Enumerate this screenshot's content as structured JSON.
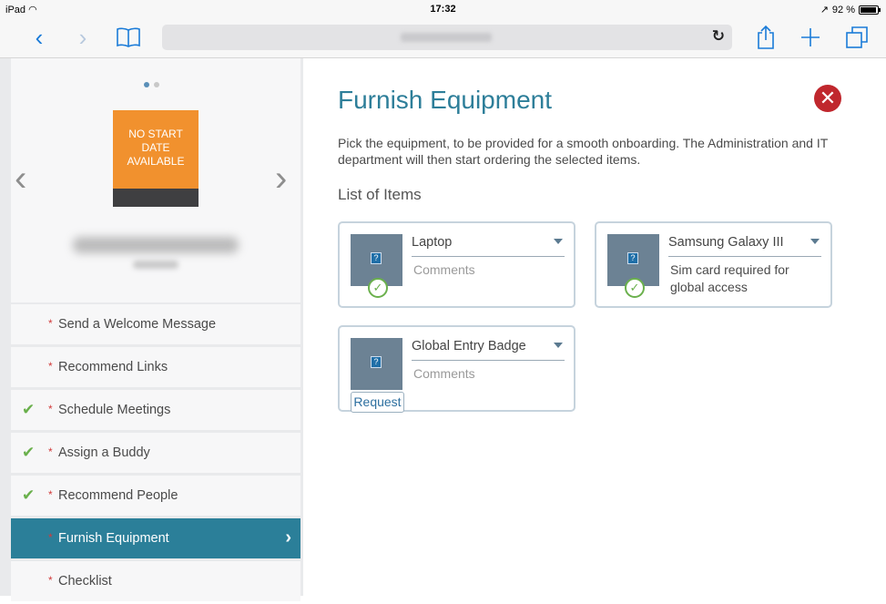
{
  "status_bar": {
    "device": "iPad",
    "time": "17:32",
    "battery": "92 %"
  },
  "browser": {
    "reload_icon": "reload-icon"
  },
  "profile": {
    "photo_text": "NO START DATE AVAILABLE"
  },
  "nav": {
    "items": [
      {
        "label": "Send a Welcome Message",
        "done": false,
        "selected": false
      },
      {
        "label": "Recommend Links",
        "done": false,
        "selected": false
      },
      {
        "label": "Schedule Meetings",
        "done": true,
        "selected": false
      },
      {
        "label": "Assign a Buddy",
        "done": true,
        "selected": false
      },
      {
        "label": "Recommend People",
        "done": true,
        "selected": false
      },
      {
        "label": "Furnish Equipment",
        "done": false,
        "selected": true
      },
      {
        "label": "Checklist",
        "done": false,
        "selected": false
      }
    ]
  },
  "main": {
    "title": "Furnish Equipment",
    "description": "Pick the equipment, to be provided for a smooth onboarding. The Administration and IT department will then start ordering the selected items.",
    "list_title": "List of Items",
    "items": [
      {
        "name": "Laptop",
        "comment": "Comments",
        "comment_is_placeholder": true,
        "requested": true
      },
      {
        "name": "Samsung Galaxy III",
        "comment": "Sim card required for global access",
        "comment_is_placeholder": false,
        "requested": true
      },
      {
        "name": "Global Entry Badge",
        "comment": "Comments",
        "comment_is_placeholder": true,
        "requested": false,
        "request_label": "Request"
      }
    ]
  },
  "colors": {
    "accent": "#2d7e99",
    "selected_nav": "#2b7f99",
    "photo_bg": "#f1912e",
    "close": "#c0272d",
    "check": "#6ab04c"
  }
}
